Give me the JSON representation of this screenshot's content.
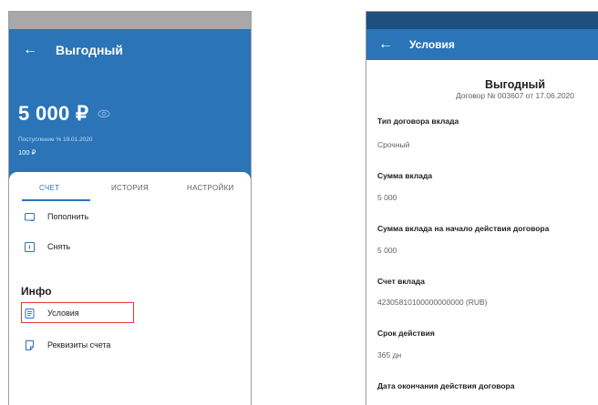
{
  "left_screen": {
    "title": "Выгодный",
    "balance": "5 000 ₽",
    "income_label": "Поступление % 19.01.2020",
    "income_value": "100 ₽",
    "tabs": [
      {
        "label": "СЧЕТ",
        "active": true
      },
      {
        "label": "ИСТОРИЯ",
        "active": false
      },
      {
        "label": "НАСТРОЙКИ",
        "active": false
      }
    ],
    "actions": [
      {
        "label": "Пополнить",
        "icon": "deposit-card-icon"
      },
      {
        "label": "Снять",
        "icon": "withdraw-icon"
      }
    ],
    "info_title": "Инфо",
    "info_items": [
      {
        "label": "Условия",
        "icon": "document-icon",
        "highlighted": true
      },
      {
        "label": "Реквизиты счета",
        "icon": "document-fold-icon",
        "highlighted": false
      }
    ]
  },
  "right_screen": {
    "title": "Условия",
    "deposit_name": "Выгодный",
    "contract": "Договор № 003607 от 17.06.2020",
    "fields": [
      {
        "label": "Тип договора вклада",
        "value": "Срочный"
      },
      {
        "label": "Сумма вклада",
        "value": "5 000"
      },
      {
        "label": "Сумма вклада на начало действия договора",
        "value": "5 000"
      },
      {
        "label": "Счет вклада",
        "value": "42305810100000000000 (RUB)"
      },
      {
        "label": "Срок действия",
        "value": "365 дн"
      },
      {
        "label": "Дата окончания действия договора",
        "value": ""
      }
    ]
  },
  "colors": {
    "brand_blue": "#2a74b7",
    "status_dark": "#1d4f7f",
    "highlight_red": "#e53935"
  }
}
